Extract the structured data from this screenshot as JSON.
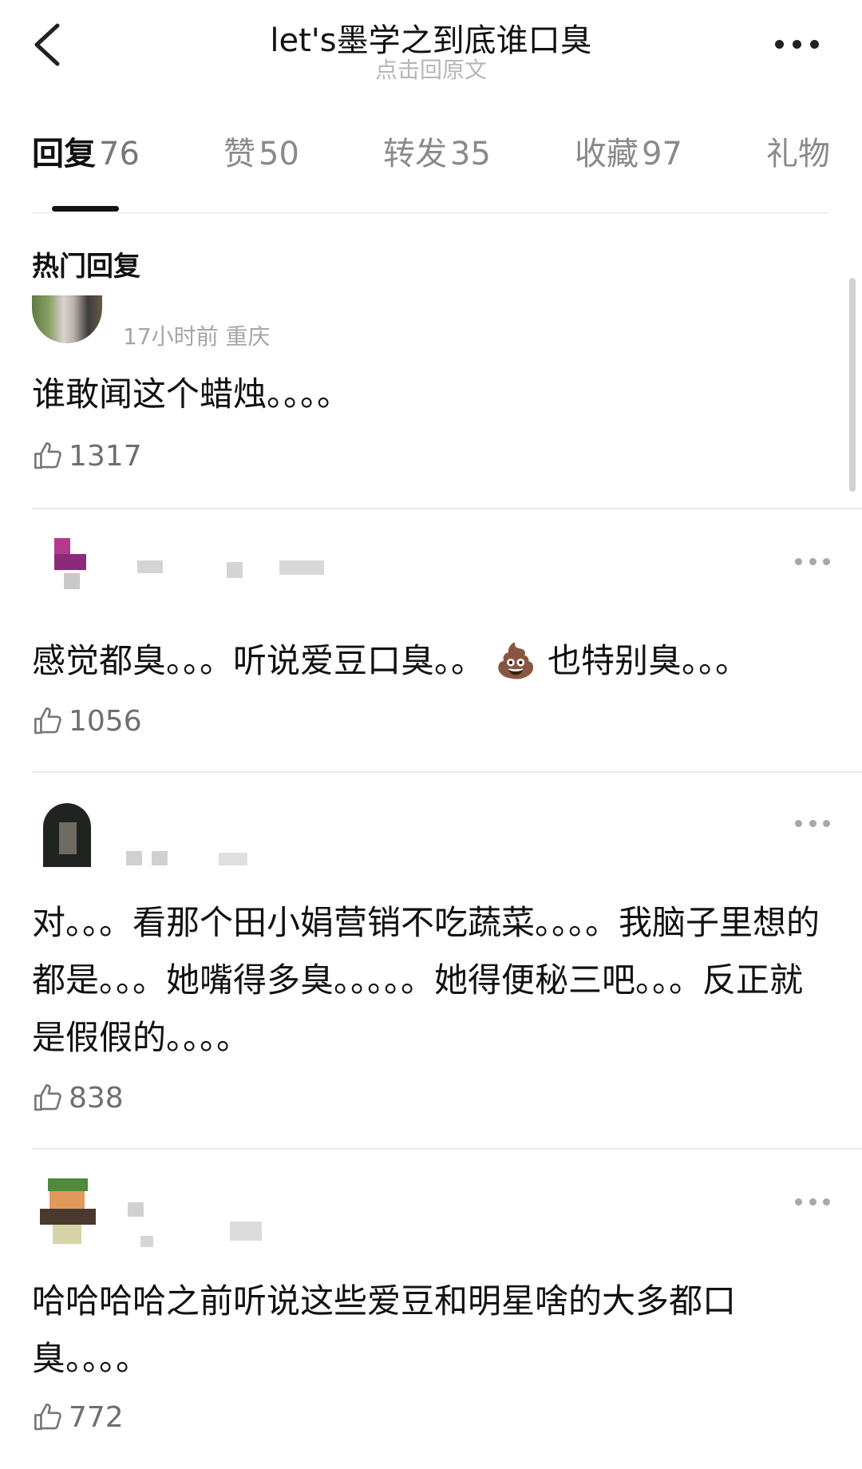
{
  "header": {
    "title": "let's墨学之到底谁口臭",
    "subtitle": "点击回原文"
  },
  "tabs": [
    {
      "label": "回复",
      "count": "76",
      "active": true
    },
    {
      "label": "赞",
      "count": "50",
      "active": false
    },
    {
      "label": "转发",
      "count": "35",
      "active": false
    },
    {
      "label": "收藏",
      "count": "97",
      "active": false
    },
    {
      "label": "礼物",
      "count": "",
      "active": false
    }
  ],
  "section_title": "热门回复",
  "comments": [
    {
      "meta": "17小时前 重庆",
      "text": "谁敢闻这个蜡烛。。。。",
      "likes": "1317"
    },
    {
      "meta": "",
      "text": "感觉都臭。。。听说爱豆口臭。。 💩 也特别臭。。。",
      "likes": "1056"
    },
    {
      "meta": "",
      "text": "对。。。看那个田小娟营销不吃蔬菜。。。。我脑子里想的都是。。。她嘴得多臭。。。。。她得便秘三吧。。。反正就是假假的。。。。",
      "likes": "838"
    },
    {
      "meta": "",
      "text": "哈哈哈哈之前听说这些爱豆和明星啥的大多都口臭。。。。",
      "likes": "772"
    }
  ],
  "icons": {
    "back": "chevron-left-icon",
    "more": "more-horizontal-icon",
    "like": "thumbs-up-icon"
  },
  "colors": {
    "text": "#111111",
    "muted": "#a6a6a6",
    "divider": "#ececec"
  }
}
